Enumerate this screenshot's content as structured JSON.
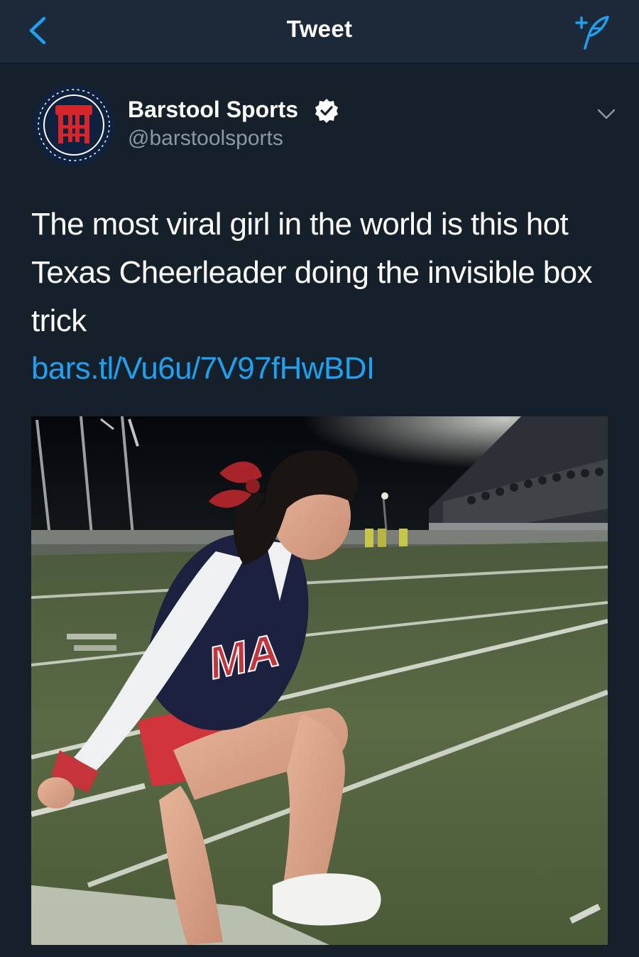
{
  "nav": {
    "title": "Tweet",
    "back_icon": "chevron-left-icon",
    "compose_icon": "compose-tweet-icon"
  },
  "tweet": {
    "author": {
      "display_name": "Barstool Sports",
      "handle": "@barstoolsports",
      "verified": true,
      "avatar_icon": "barstool-logo-avatar"
    },
    "text": "The most viral girl in the world is this hot Texas Cheerleader doing the invisible box trick",
    "link": "bars.tl/Vu6u/7V97fHwBDI",
    "media_logo_text": "MA",
    "media": {
      "type": "photo",
      "subject": "cheerleader on football field at night"
    }
  },
  "colors": {
    "background": "#15202b",
    "nav_background": "#1c2938",
    "accent": "#1da1f2",
    "secondary_text": "#8899a6",
    "primary_text": "#ffffff"
  }
}
